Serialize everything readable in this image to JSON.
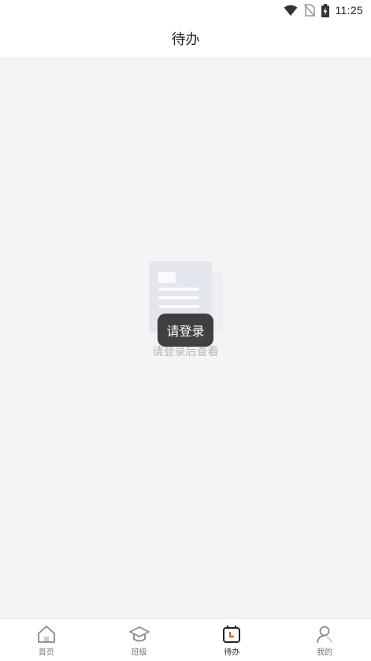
{
  "status_bar": {
    "time": "11:25",
    "icons": [
      "wifi-icon",
      "no-sim-icon",
      "battery-charging-icon"
    ]
  },
  "header": {
    "title": "待办"
  },
  "empty_state": {
    "icon": "document-placeholder-icon",
    "message": "请登录后查看"
  },
  "toast": {
    "text": "请登录"
  },
  "tab_bar": {
    "active_color": "#e8551e",
    "items": [
      {
        "label": "首页",
        "icon": "home-icon"
      },
      {
        "label": "班级",
        "icon": "graduation-cap-icon"
      },
      {
        "label": "待办",
        "icon": "calendar-todo-icon",
        "active": true
      },
      {
        "label": "我的",
        "icon": "person-icon"
      }
    ]
  }
}
